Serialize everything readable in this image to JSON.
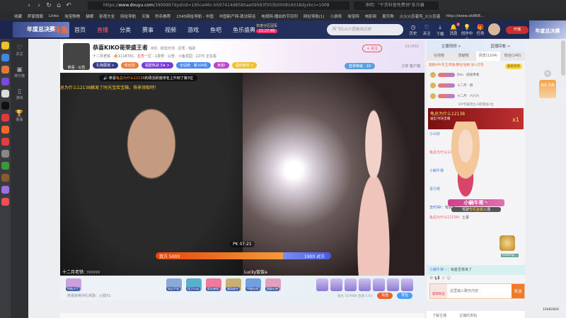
{
  "browser": {
    "url_domain": "www.douyu.com",
    "url_path": "/3999997dyshid=195ce46c-b597414d858Sae09583f303b000816018dyshci=1008",
    "search_placeholder": "净网：\"干货科普免费领\"系诈骗",
    "bookmarks": [
      "收藏",
      "萨家旗舰",
      "Links",
      "淘宝购物",
      "猫眼",
      "影视大全",
      "网址导航",
      "天猫",
      "秒杀推荐",
      "2345网址导航 - 中国",
      "中国新产网-政法禁运",
      "电视网-播出的节目列",
      "网址导航(1)",
      "小游戏",
      "淘宝网",
      "电影网",
      "麦乐购",
      "火火火忍者传_火火忍者",
      "http://www.ok868..."
    ]
  },
  "nav": {
    "logo": "年度总决赛",
    "brand": "斗鱼",
    "items": [
      "首页",
      "直播",
      "分类",
      "赛事",
      "视频",
      "游戏",
      "鱼吧",
      "鱼乐盛典"
    ],
    "active": 1,
    "event_label": "年度分区冠军",
    "event_time": "21:27:49",
    "search_placeholder": "阿飞队从小团被淘汰掉",
    "icons": [
      {
        "icon": "history-icon",
        "label": "历史"
      },
      {
        "icon": "heart-icon",
        "label": "关注"
      },
      {
        "icon": "download-icon",
        "label": "下载"
      },
      {
        "icon": "bell-icon",
        "label": "消息",
        "badge": "2"
      },
      {
        "icon": "bulb-icon",
        "label": "创作中心"
      },
      {
        "icon": "gift-icon",
        "label": "任务"
      }
    ],
    "live_button": "开播",
    "banner": "年度总决赛"
  },
  "sidebar": {
    "items": [
      "关注",
      "排行榜",
      "游戏",
      "赛事"
    ]
  },
  "streamer": {
    "name": "恭喜KIKO哥荣盛王者",
    "tag": "待处",
    "category": "颜值天地 · 星秀 · 唱歌",
    "avatar_caption": "恭喜 · 公告",
    "level": "十二月老铁",
    "hot": "1118781",
    "vlabel": "星秀一区",
    "fans": "1发呀",
    "notice": "公告：小鱼花园",
    "viewers": "2270 正在看",
    "badges": [
      {
        "text": "礼物展馆 >",
        "color": "#3a3a8a"
      },
      {
        "text": "粉丝团",
        "color": "#f07a3a"
      },
      {
        "text": "福盟热战 3★ >",
        "color": "#7a3ad8"
      },
      {
        "text": "全站榜 · 第104名",
        "color": "#4a8af0"
      },
      {
        "text": "黄金Ⅰ",
        "color": "#c040d0"
      },
      {
        "text": "福利榜单 >",
        "color": "#f0c030"
      }
    ],
    "follow": "+ 关注",
    "followers": "612892",
    "level_btn": "登录等级 · 10",
    "share": "分享",
    "report": "客户端"
  },
  "video": {
    "notice_prefix": "恭喜",
    "notice_user": "龟总为什么12138",
    "notice_text": "的周活跃度排名上升到了第3位",
    "scroll_msg": "总为什么12138触发了时光宝库宝箱，快来领取吧！",
    "pk_timer": "PK 07:21",
    "pk_us_label": "我方 5000",
    "pk_them_label": "1900 对方",
    "pk_us": 5000,
    "pk_them": 1900,
    "left_name": "十二月老铁",
    "left_score": "399999",
    "right_name": "Lucky饭饭a"
  },
  "gifts": {
    "items": [
      "特效大厅",
      "钻石手表",
      "保卫行动",
      "疯狂感恩",
      "遇游星空",
      "甲醛在线",
      "超级礼物"
    ],
    "reward": "恭喜获得涉礼奖励：火箭X1",
    "stats": "鱼丸 519988  鱼翅 5.63",
    "recharge": "充值",
    "backpack": "背包"
  },
  "chat": {
    "top": [
      "主播视频 >",
      "直播回看 >"
    ],
    "tabs": [
      "在线榜",
      "贡献榜",
      "贵宾(1104)",
      "粉丝(140)"
    ],
    "active_tab": 2,
    "vip_text": "超级VIP/守卫/贵族/爵位/钻粉 进入可见",
    "vip_btn": "解锁贵宾",
    "vips": [
      "Deu · 超级勇者",
      "十二月 · 翔",
      "十二月 · 六六六"
    ],
    "vip_footer": "VIP专属席位-6席增加2位",
    "gift_popup": {
      "user": "龟总为什么12138",
      "text": "送出  时光宝箱",
      "count": "x1"
    },
    "messages": [
      {
        "user": "小么好",
        "text": ""
      },
      {
        "user": "龟总为什么12138",
        "text": ""
      },
      {
        "user": "小蜗牛得",
        "text": ""
      },
      {
        "user": "青行呀",
        "text": ""
      },
      {
        "user": "查时得f",
        "text": "有说声了"
      },
      {
        "user": "龟总为什么12138",
        "text": "土豪"
      }
    ],
    "enter_name": "小蜗牛哥丶",
    "enter_text_a": "驾驶",
    "enter_text_b": "粤机鱼鳞",
    "enter_text_c": "入场",
    "loading": "loading...",
    "last_msg": {
      "user": "小蜗牛得丶",
      "text": "铂金至尊来了"
    },
    "input_badge": "超级粉丝",
    "input_placeholder": "这里输入聊天内容",
    "send": "发送"
  },
  "right": {
    "promo": "周年 庆典",
    "counter": "10482820"
  },
  "info_tabs": [
    "了解主播",
    "主播的发帖"
  ]
}
